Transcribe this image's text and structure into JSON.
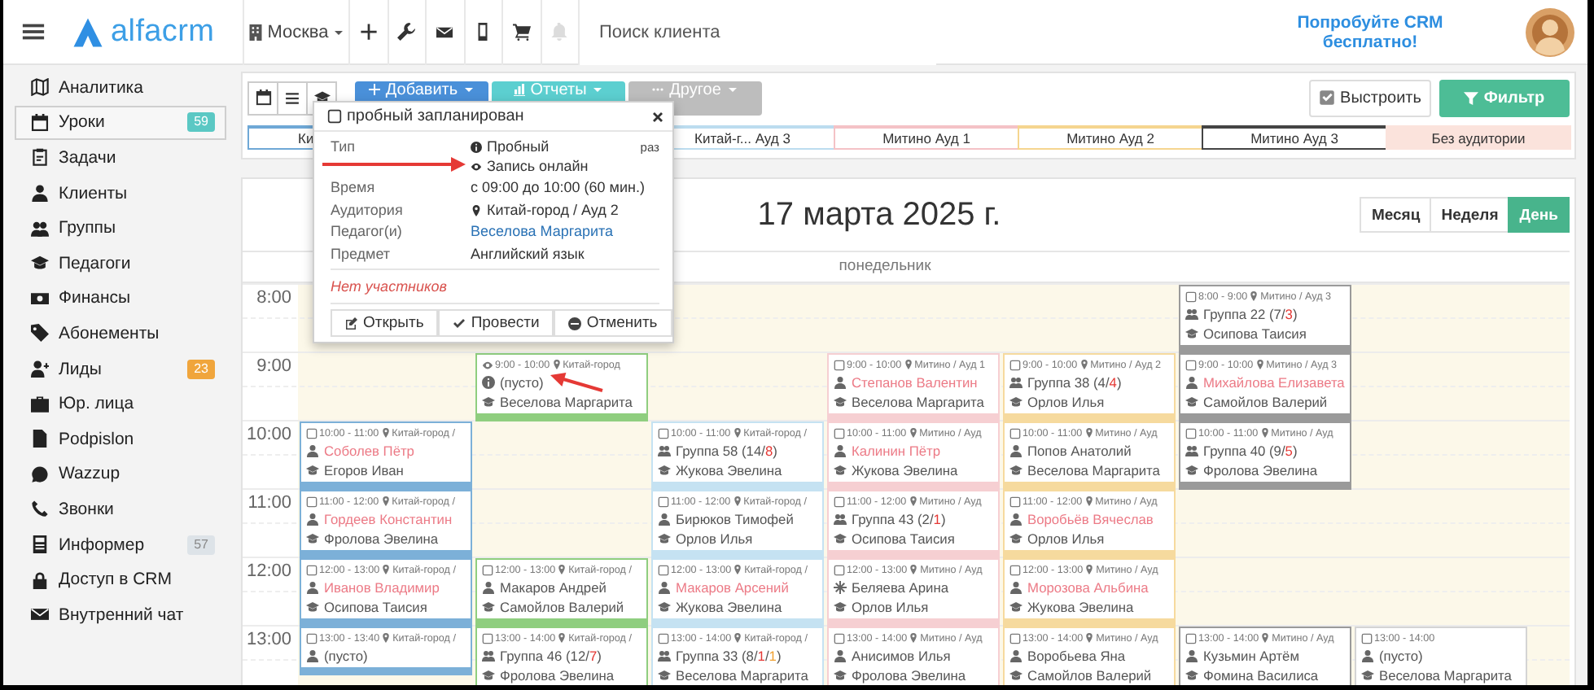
{
  "topbar": {
    "logo": "alfacrm",
    "city": "Москва",
    "search": {
      "placeholder": "Поиск клиента"
    },
    "promo": "Попробуйте CRM бесплатно!"
  },
  "sidebar": {
    "items": [
      {
        "label": "Аналитика",
        "selected": false
      },
      {
        "label": "Уроки",
        "selected": true,
        "badge": {
          "text": "59",
          "color": "#5bc8c4"
        }
      },
      {
        "label": "Задачи",
        "selected": false
      },
      {
        "label": "Клиенты",
        "selected": false
      },
      {
        "label": "Группы",
        "selected": false
      },
      {
        "label": "Педагоги",
        "selected": false
      },
      {
        "label": "Финансы",
        "selected": false
      },
      {
        "label": "Абонементы",
        "selected": false
      },
      {
        "label": "Лиды",
        "selected": false,
        "badge": {
          "text": "23",
          "color": "#f0a53c"
        }
      },
      {
        "label": "Юр. лица",
        "selected": false
      },
      {
        "label": "Podpislon",
        "selected": false
      },
      {
        "label": "Wazzup",
        "selected": false
      },
      {
        "label": "Звонки",
        "selected": false
      },
      {
        "label": "Информер",
        "selected": false,
        "badge": {
          "text": "57",
          "color": "#dde3e8"
        }
      },
      {
        "label": "Доступ в CRM",
        "selected": false
      },
      {
        "label": "Внутренний чат",
        "selected": false
      }
    ]
  },
  "toolbar": {
    "actions": [
      {
        "label": "Добавить",
        "color": "#4a90d9"
      },
      {
        "label": "Отчеты",
        "color": "#5ccfd0"
      },
      {
        "label": "Другое",
        "color": "#bdbdbd"
      }
    ],
    "arrange": {
      "label": "Выстроить",
      "checked": true
    },
    "filter": {
      "label": "Фильтр"
    },
    "room_tabs": [
      {
        "label": "Ки",
        "kind": "partial",
        "color": "#6fa8d6"
      },
      {
        "label": "Китай-г... Ауд 3",
        "kind": "room",
        "color": "#bcdcef"
      },
      {
        "label": "Митино Ауд 1",
        "kind": "room",
        "color": "#f4c2c6"
      },
      {
        "label": "Митино Ауд 2",
        "kind": "room",
        "color": "#f5d58f"
      },
      {
        "label": "Митино Ауд 3",
        "kind": "room",
        "color": "#444444"
      },
      {
        "label": "Без аудитории",
        "kind": "none",
        "color": "#fbe3dc"
      }
    ]
  },
  "calendar": {
    "title": "17 марта 2025 г.",
    "views": [
      {
        "label": "Месяц",
        "selected": false
      },
      {
        "label": "Неделя",
        "selected": false
      },
      {
        "label": "День",
        "selected": true
      }
    ],
    "day": "понедельник",
    "hours": [
      "8:00",
      "9:00",
      "10:00",
      "11:00",
      "12:00",
      "13:00"
    ],
    "rooms": [
      {
        "color": "#7cb0d8",
        "slots": [
          {
            "kind": "free"
          },
          {
            "kind": "free"
          },
          {
            "kind": "lesson",
            "online": false,
            "time": "10:00 - 11:00",
            "place": "Китай-город /",
            "who": {
              "kind": "person",
              "parts": [
                {
                  "text": "Соболев Пётр",
                  "kind": "debt"
                }
              ]
            },
            "teacher": "Егоров Иван"
          },
          {
            "kind": "lesson",
            "online": false,
            "time": "11:00 - 12:00",
            "place": "Китай-город /",
            "who": {
              "kind": "person",
              "parts": [
                {
                  "text": "Гордеев Константин",
                  "kind": "debt"
                }
              ]
            },
            "teacher": "Фролова Эвелина"
          },
          {
            "kind": "lesson",
            "online": false,
            "time": "12:00 - 13:00",
            "place": "Китай-город /",
            "who": {
              "kind": "person",
              "parts": [
                {
                  "text": "Иванов Владимир",
                  "kind": "debt"
                }
              ]
            },
            "teacher": "Осипова Таисия"
          },
          {
            "kind": "lesson",
            "online": false,
            "time": "13:00 - 13:40",
            "place": "Китай-город /",
            "who": {
              "kind": "person",
              "parts": [
                {
                  "text": "(пусто)",
                  "kind": "plain"
                }
              ]
            }
          }
        ]
      },
      {
        "color": "#8fce7f",
        "slots": [
          {
            "kind": "free"
          },
          {
            "kind": "lesson",
            "online": true,
            "time": "9:00 - 10:00",
            "place": "Китай-город",
            "who": {
              "kind": "trial",
              "parts": [
                {
                  "text": "(пусто)",
                  "kind": "plain"
                }
              ]
            },
            "teacher": "Веселова Маргарита"
          },
          {
            "kind": "free"
          },
          {
            "kind": "free"
          },
          {
            "kind": "lesson",
            "online": false,
            "time": "12:00 - 13:00",
            "place": "Китай-город /",
            "who": {
              "kind": "person",
              "parts": [
                {
                  "text": "Макаров Андрей",
                  "kind": "plain"
                }
              ]
            },
            "teacher": "Самойлов Валерий"
          },
          {
            "kind": "lesson",
            "online": false,
            "time": "13:00 - 14:00",
            "place": "Китай-город /",
            "who": {
              "kind": "group",
              "parts": [
                {
                  "text": "Группа 46 (12/",
                  "kind": "plain"
                },
                {
                  "text": "7",
                  "kind": "absent"
                },
                {
                  "text": ")",
                  "kind": "plain"
                }
              ]
            },
            "teacher": "Фролова Эвелина"
          }
        ]
      },
      {
        "color": "#c5e2f2",
        "slots": [
          {
            "kind": "free"
          },
          {
            "kind": "free"
          },
          {
            "kind": "lesson",
            "online": false,
            "time": "10:00 - 11:00",
            "place": "Китай-город /",
            "who": {
              "kind": "group",
              "parts": [
                {
                  "text": "Группа 58 (14/",
                  "kind": "plain"
                },
                {
                  "text": "8",
                  "kind": "absent"
                },
                {
                  "text": ")",
                  "kind": "plain"
                }
              ]
            },
            "teacher": "Жукова Эвелина"
          },
          {
            "kind": "lesson",
            "online": false,
            "time": "11:00 - 12:00",
            "place": "Китай-город /",
            "who": {
              "kind": "person",
              "parts": [
                {
                  "text": "Бирюков Тимофей",
                  "kind": "plain"
                }
              ]
            },
            "teacher": "Орлов Илья"
          },
          {
            "kind": "lesson",
            "online": false,
            "time": "12:00 - 13:00",
            "place": "Китай-город /",
            "who": {
              "kind": "person",
              "parts": [
                {
                  "text": "Макаров Арсений",
                  "kind": "debt"
                }
              ]
            },
            "teacher": "Жукова Эвелина"
          },
          {
            "kind": "lesson",
            "online": false,
            "time": "13:00 - 14:00",
            "place": "Китай-город /",
            "who": {
              "kind": "group",
              "parts": [
                {
                  "text": "Группа 33 (8/",
                  "kind": "plain"
                },
                {
                  "text": "1",
                  "kind": "absent"
                },
                {
                  "text": "/",
                  "kind": "plain"
                },
                {
                  "text": "1",
                  "kind": "partial"
                },
                {
                  "text": ")",
                  "kind": "plain"
                }
              ]
            },
            "teacher": "Веселова Маргарита"
          }
        ]
      },
      {
        "color": "#f6cfd2",
        "slots": [
          {
            "kind": "free"
          },
          {
            "kind": "lesson",
            "online": false,
            "time": "9:00 - 10:00",
            "place": "Митино / Ауд 1",
            "who": {
              "kind": "person",
              "parts": [
                {
                  "text": "Степанов Валентин",
                  "kind": "debt"
                }
              ]
            },
            "teacher": "Веселова Маргарита"
          },
          {
            "kind": "lesson",
            "online": false,
            "time": "10:00 - 11:00",
            "place": "Митино / Ауд",
            "who": {
              "kind": "person",
              "parts": [
                {
                  "text": "Калинин Пётр",
                  "kind": "debt"
                }
              ]
            },
            "teacher": "Жукова Эвелина"
          },
          {
            "kind": "lesson",
            "online": false,
            "time": "11:00 - 12:00",
            "place": "Митино / Ауд",
            "who": {
              "kind": "group",
              "parts": [
                {
                  "text": "Группа 43 (2/",
                  "kind": "plain"
                },
                {
                  "text": "1",
                  "kind": "absent"
                },
                {
                  "text": ")",
                  "kind": "plain"
                }
              ]
            },
            "teacher": "Осипова Таисия"
          },
          {
            "kind": "lesson",
            "online": false,
            "time": "12:00 - 13:00",
            "place": "Митино / Ауд",
            "who": {
              "kind": "other",
              "parts": [
                {
                  "text": "Беляева Арина",
                  "kind": "plain"
                }
              ]
            },
            "teacher": "Орлов Илья"
          },
          {
            "kind": "lesson",
            "online": false,
            "time": "13:00 - 14:00",
            "place": "Митино / Ауд",
            "who": {
              "kind": "person",
              "parts": [
                {
                  "text": "Анисимов Илья",
                  "kind": "plain"
                }
              ]
            },
            "teacher": "Фролова Эвелина"
          }
        ]
      },
      {
        "color": "#f6da9e",
        "slots": [
          {
            "kind": "free"
          },
          {
            "kind": "lesson",
            "online": false,
            "time": "9:00 - 10:00",
            "place": "Митино / Ауд 2",
            "who": {
              "kind": "group",
              "parts": [
                {
                  "text": "Группа 38 (4/",
                  "kind": "plain"
                },
                {
                  "text": "4",
                  "kind": "absent"
                },
                {
                  "text": ")",
                  "kind": "plain"
                }
              ]
            },
            "teacher": "Орлов Илья"
          },
          {
            "kind": "lesson",
            "online": false,
            "time": "10:00 - 11:00",
            "place": "Митино / Ауд",
            "who": {
              "kind": "person",
              "parts": [
                {
                  "text": "Попов Анатолий",
                  "kind": "plain"
                }
              ]
            },
            "teacher": "Веселова Маргарита"
          },
          {
            "kind": "lesson",
            "online": false,
            "time": "11:00 - 12:00",
            "place": "Митино / Ауд",
            "who": {
              "kind": "person",
              "parts": [
                {
                  "text": "Воробьёв Вячеслав",
                  "kind": "debt"
                }
              ]
            },
            "teacher": "Орлов Илья"
          },
          {
            "kind": "lesson",
            "online": false,
            "time": "12:00 - 13:00",
            "place": "Митино / Ауд",
            "who": {
              "kind": "person",
              "parts": [
                {
                  "text": "Морозова Альбина",
                  "kind": "debt"
                }
              ]
            },
            "teacher": "Жукова Эвелина"
          },
          {
            "kind": "lesson",
            "online": false,
            "time": "13:00 - 14:00",
            "place": "Митино / Ауд",
            "who": {
              "kind": "person",
              "parts": [
                {
                  "text": "Воробьева Яна",
                  "kind": "plain"
                }
              ]
            },
            "teacher": "Самойлов Валерий"
          }
        ]
      },
      {
        "color": "#9a9a9a",
        "slots": [
          {
            "kind": "lesson",
            "online": false,
            "time": "8:00 - 9:00",
            "place": "Митино / Ауд 3",
            "who": {
              "kind": "group",
              "parts": [
                {
                  "text": "Группа 22 (7/",
                  "kind": "plain"
                },
                {
                  "text": "3",
                  "kind": "absent"
                },
                {
                  "text": ")",
                  "kind": "plain"
                }
              ]
            },
            "teacher": "Осипова Таисия"
          },
          {
            "kind": "lesson",
            "online": false,
            "time": "9:00 - 10:00",
            "place": "Митино / Ауд 3",
            "who": {
              "kind": "person",
              "parts": [
                {
                  "text": "Михайлова Елизавета",
                  "kind": "debt"
                }
              ]
            },
            "teacher": "Самойлов Валерий"
          },
          {
            "kind": "lesson",
            "online": false,
            "time": "10:00 - 11:00",
            "place": "Митино / Ауд",
            "who": {
              "kind": "group",
              "parts": [
                {
                  "text": "Группа 40 (9/",
                  "kind": "plain"
                },
                {
                  "text": "5",
                  "kind": "absent"
                },
                {
                  "text": ")",
                  "kind": "plain"
                }
              ]
            },
            "teacher": "Фролова Эвелина"
          },
          {
            "kind": "free"
          },
          {
            "kind": "free"
          },
          {
            "kind": "lesson",
            "online": false,
            "time": "13:00 - 14:00",
            "place": "Митино / Ауд",
            "who": {
              "kind": "person",
              "parts": [
                {
                  "text": "Кузьмин Артём",
                  "kind": "plain"
                }
              ]
            },
            "teacher": "Фомина Василиса"
          }
        ]
      },
      {
        "color": "#d4d4d4",
        "slots": [
          {
            "kind": "free"
          },
          {
            "kind": "free"
          },
          {
            "kind": "free"
          },
          {
            "kind": "free"
          },
          {
            "kind": "free"
          },
          {
            "kind": "lesson",
            "online": false,
            "time": "13:00 - 14:00",
            "who": {
              "kind": "person",
              "parts": [
                {
                  "text": "(пусто)",
                  "kind": "plain"
                }
              ]
            },
            "teacher": "Веселова Маргарита"
          }
        ]
      }
    ]
  },
  "popup": {
    "title": "пробный запланирован",
    "checked": false,
    "rows": [
      {
        "label": "Тип",
        "values": [
          {
            "kind": "trial",
            "text": "Пробный"
          },
          {
            "kind": "online",
            "text": "Запись онлайн"
          }
        ],
        "note": "раз"
      },
      {
        "label": "Время",
        "values": [
          {
            "kind": "text",
            "text": "с 09:00 до 10:00 (60 мин.)"
          }
        ]
      },
      {
        "label": "Аудитория",
        "values": [
          {
            "kind": "place",
            "text": "Китай-город / Ауд 2"
          }
        ]
      },
      {
        "label": "Педагог(и)",
        "values": [
          {
            "kind": "link",
            "text": "Веселова Маргарита"
          }
        ]
      },
      {
        "label": "Предмет",
        "values": [
          {
            "kind": "text",
            "text": "Английский язык"
          }
        ]
      }
    ],
    "empty_note": "Нет участников",
    "buttons": [
      {
        "kind": "open",
        "label": "Открыть"
      },
      {
        "kind": "conduct",
        "label": "Провести"
      },
      {
        "kind": "cancel",
        "label": "Отменить"
      }
    ]
  },
  "annotations": [
    {
      "kind": "arrow"
    },
    {
      "kind": "arrow"
    }
  ]
}
